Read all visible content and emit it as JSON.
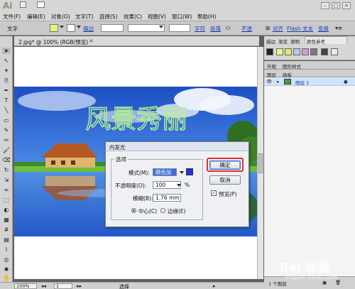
{
  "app": {
    "logo": "Ai",
    "menu": [
      "文件(F)",
      "编辑(E)",
      "对象(O)",
      "文字(T)",
      "选择(S)",
      "效果(C)",
      "视图(V)",
      "窗口(W)",
      "帮助(H)"
    ],
    "window_buttons": [
      "–",
      "□",
      "×"
    ]
  },
  "control_bar": {
    "label": "文字",
    "fill_color": "#e5f57a",
    "stroke_label": "描边",
    "char_label": "字符",
    "para_label": "段落",
    "opacity_label": "不透",
    "align_label": "对齐",
    "flash_label": "Flash 文本",
    "transform_label": "变换"
  },
  "document": {
    "tab_label": "2.jpg* @ 100% (RGB/预览)",
    "close_glyph": "×",
    "artwork_title": "风景秀丽",
    "artwork_title_color": "#b8f28c"
  },
  "right_panel": {
    "top_tabs": [
      "描边",
      "渐变",
      "透明",
      "颜色参考"
    ],
    "appearance_tabs": [
      "外观",
      "图形样式"
    ],
    "layers_tabs": [
      "图层",
      "画板"
    ],
    "layer_name": "图层 1",
    "layer_count": "1 个图层"
  },
  "dialog": {
    "title": "内发光",
    "group_label": "选项",
    "mode_label": "模式(M):",
    "mode_value": "颜色加深",
    "opacity_label": "不透明度(O):",
    "opacity_value": "100",
    "opacity_unit": "%",
    "blur_label": "模糊(B):",
    "blur_value": "1.76 mm",
    "radio_center": "中心(C)",
    "radio_edge": "边缘(E)",
    "ok_label": "确定",
    "cancel_label": "取消",
    "preview_label": "预览(P)",
    "preview_checked": true,
    "glow_color": "#2a2ae6"
  },
  "status_bar": {
    "zoom": "100%",
    "page": "1",
    "tool_label": "选择"
  },
  "watermark": {
    "main": "Bai 经验",
    "sub": "jingyan.baidu.com"
  }
}
